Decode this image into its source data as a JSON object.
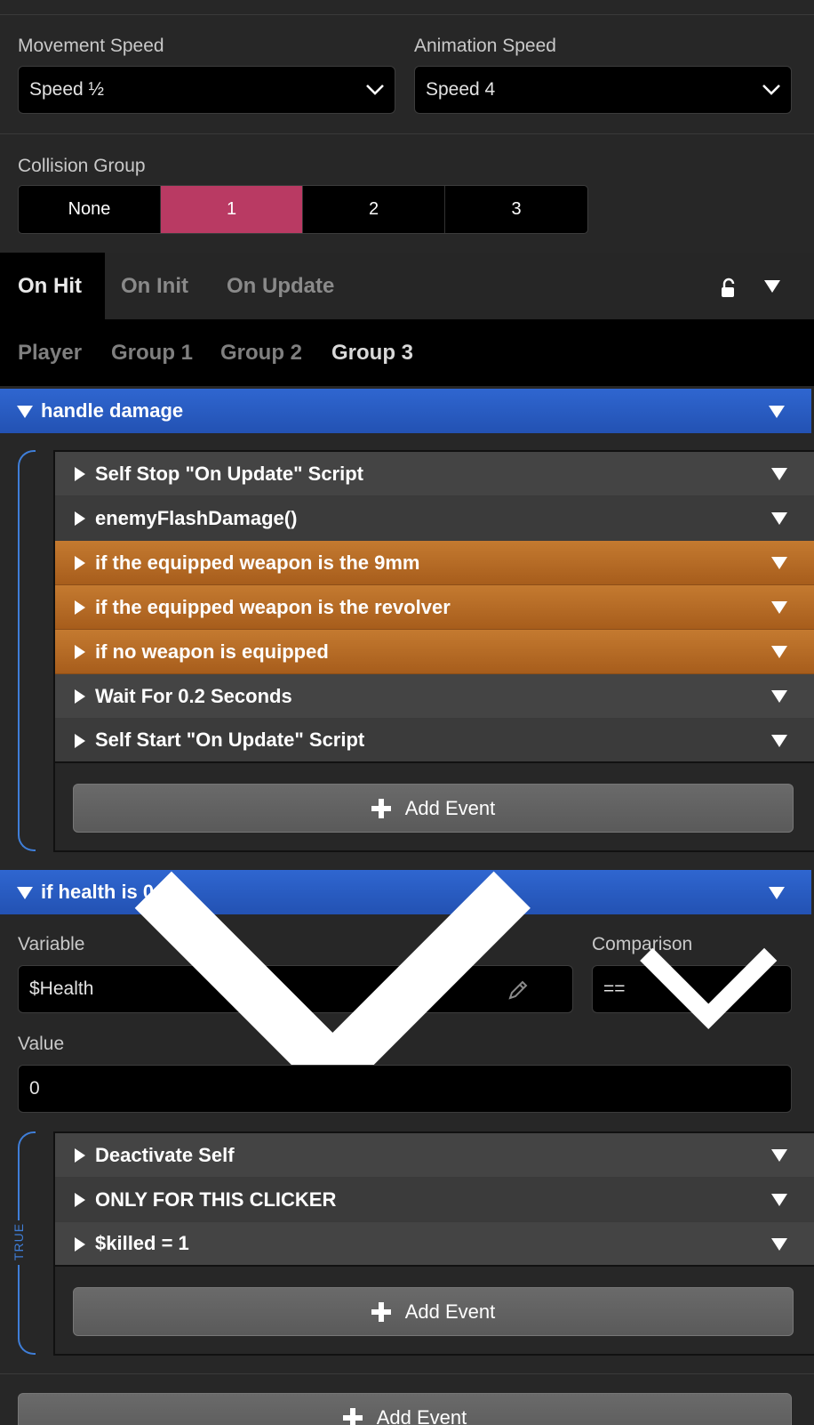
{
  "movement_speed": {
    "label": "Movement Speed",
    "value": "Speed ½"
  },
  "animation_speed": {
    "label": "Animation Speed",
    "value": "Speed 4"
  },
  "collision_group": {
    "label": "Collision Group",
    "options": [
      "None",
      "1",
      "2",
      "3"
    ],
    "selected": "1"
  },
  "script_tabs": {
    "items": [
      "On Hit",
      "On Init",
      "On Update"
    ],
    "selected": "On Hit"
  },
  "group_tabs": {
    "items": [
      "Player",
      "Group 1",
      "Group 2",
      "Group 3"
    ],
    "selected": "Group 3"
  },
  "handle_damage": {
    "title": "handle damage",
    "events": [
      {
        "label": "Self Stop \"On Update\" Script",
        "style": "gray"
      },
      {
        "label": "enemyFlashDamage()",
        "style": "gray"
      },
      {
        "label": "if the equipped weapon is the 9mm",
        "style": "orange"
      },
      {
        "label": "if the equipped weapon is the revolver",
        "style": "orange"
      },
      {
        "label": "if no weapon is equipped",
        "style": "orange"
      },
      {
        "label": "Wait For 0.2 Seconds",
        "style": "gray"
      },
      {
        "label": "Self Start \"On Update\" Script",
        "style": "gray"
      }
    ],
    "add_label": "Add Event"
  },
  "if_health": {
    "title": "if health is 0",
    "variable_label": "Variable",
    "variable_value": "$Health",
    "comparison_label": "Comparison",
    "comparison_value": "==",
    "value_label": "Value",
    "value": "0",
    "true_label": "TRUE",
    "events": [
      {
        "label": "Deactivate Self"
      },
      {
        "label": "ONLY FOR THIS CLICKER"
      },
      {
        "label": "$killed = 1"
      }
    ],
    "add_label": "Add Event"
  },
  "bottom_add_label": "Add Event",
  "colors": {
    "accent_pink": "#b93a63",
    "header_blue": "#2f66d0",
    "orange": "#c47a30",
    "bracket_blue": "#3f7ed8"
  },
  "icons": [
    "chevron-down-icon",
    "lock-open-icon",
    "triangle-down-icon",
    "triangle-right-icon",
    "plus-icon",
    "pencil-icon"
  ]
}
